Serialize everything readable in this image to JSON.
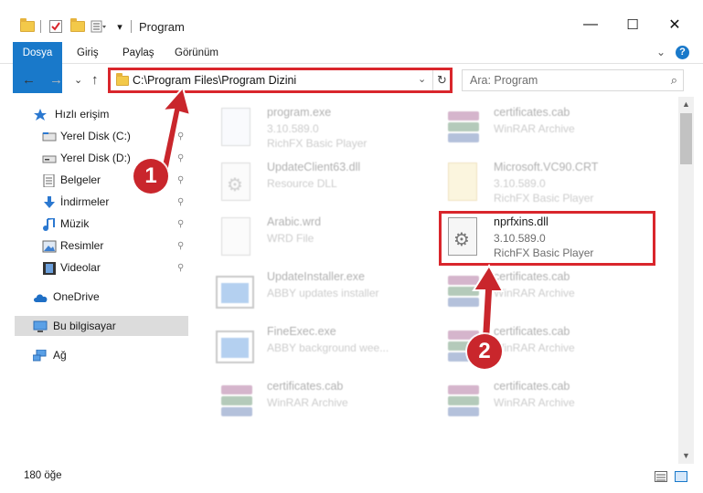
{
  "window": {
    "title": "Program",
    "minimize": "—",
    "maximize": "☐",
    "close": "✕"
  },
  "ribbon": {
    "tabs": [
      "Dosya",
      "Giriş",
      "Paylaş",
      "Görünüm"
    ],
    "expand": "⌄",
    "help": "?"
  },
  "nav": {
    "back": "←",
    "forward": "→",
    "recent": "⌄",
    "up": "↑"
  },
  "address": {
    "path": "C:\\Program Files\\Program Dizini",
    "dropdown": "⌄",
    "refresh": "↻"
  },
  "search": {
    "placeholder": "Ara: Program",
    "icon": "⌕"
  },
  "sidebar": {
    "items": [
      {
        "label": "Hızlı erişim",
        "icon": "star-icon",
        "pinned": false
      },
      {
        "label": "Yerel Disk (C:)",
        "icon": "drive-icon",
        "pinned": true
      },
      {
        "label": "Yerel Disk (D:)",
        "icon": "drive-icon",
        "pinned": true
      },
      {
        "label": "Belgeler",
        "icon": "documents-icon",
        "pinned": true
      },
      {
        "label": "İndirmeler",
        "icon": "download-icon",
        "pinned": true
      },
      {
        "label": "Müzik",
        "icon": "music-icon",
        "pinned": true
      },
      {
        "label": "Resimler",
        "icon": "pictures-icon",
        "pinned": true
      },
      {
        "label": "Videolar",
        "icon": "videos-icon",
        "pinned": true
      },
      {
        "label": "OneDrive",
        "icon": "cloud-icon",
        "pinned": false
      },
      {
        "label": "Bu bilgisayar",
        "icon": "computer-icon",
        "pinned": false,
        "selected": true
      },
      {
        "label": "Ağ",
        "icon": "network-icon",
        "pinned": false
      }
    ],
    "pin_glyph": "📌"
  },
  "files": [
    {
      "name": "program.exe",
      "line2": "3.10.589.0",
      "line3": "RichFX Basic Player",
      "icon": "exe-icon",
      "faded": true
    },
    {
      "name": "certificates.cab",
      "line2": "WinRAR Archive",
      "line3": "",
      "icon": "winrar-icon",
      "faded": true
    },
    {
      "name": "UpdateClient63.dll",
      "line2": "Resource DLL",
      "line3": "",
      "icon": "dll-icon",
      "faded": true
    },
    {
      "name": "Microsoft.VC90.CRT",
      "line2": "3.10.589.0",
      "line3": "RichFX Basic Player",
      "icon": "folder-icon",
      "faded": true
    },
    {
      "name": "Arabic.wrd",
      "line2": "WRD File",
      "line3": "",
      "icon": "file-icon",
      "faded": true
    },
    {
      "name": "nprfxins.dll",
      "line2": "3.10.589.0",
      "line3": "RichFX Basic Player",
      "icon": "dll-gear-icon",
      "faded": false
    },
    {
      "name": "UpdateInstaller.exe",
      "line2": "ABBY updates installer",
      "line3": "",
      "icon": "app-window-icon",
      "faded": true
    },
    {
      "name": "certificates.cab",
      "line2": "WinRAR Archive",
      "line3": "",
      "icon": "winrar-icon",
      "faded": true
    },
    {
      "name": "FineExec.exe",
      "line2": "ABBY background wee...",
      "line3": "",
      "icon": "app-window-icon",
      "faded": true
    },
    {
      "name": "certificates.cab",
      "line2": "WinRAR Archive",
      "line3": "",
      "icon": "winrar-icon",
      "faded": true
    },
    {
      "name": "certificates.cab",
      "line2": "WinRAR Archive",
      "line3": "",
      "icon": "winrar-icon",
      "faded": true
    },
    {
      "name": "certificates.cab",
      "line2": "WinRAR Archive",
      "line3": "",
      "icon": "winrar-icon",
      "faded": true
    }
  ],
  "status": {
    "count": "180 öğe"
  },
  "annotations": {
    "badge1": "1",
    "badge2": "2",
    "color": "#c9262c"
  }
}
